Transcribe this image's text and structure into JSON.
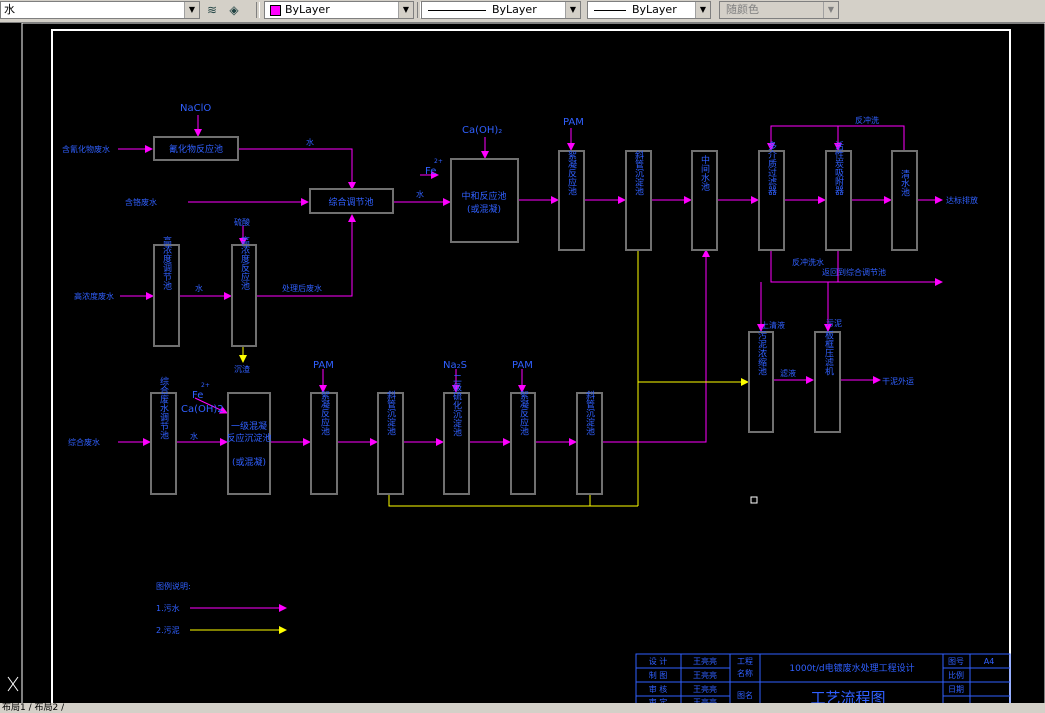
{
  "toolbar": {
    "layer_name": "水",
    "color_value": "ByLayer",
    "linetype_value": "ByLayer",
    "lineweight_value": "ByLayer",
    "plotstyle_value": "随颜色",
    "colors": {
      "swatch": "#ff00ff"
    }
  },
  "drawing": {
    "inputs": {
      "cyanide": "含氰化物废水",
      "chromium": "含铬废水",
      "heavy_metal": "高浓度废水",
      "mixed": "综合废水"
    },
    "reagents": {
      "naclo": "NaClO",
      "caoh2": "Ca(OH)₂",
      "pam1": "PAM",
      "fe": "Fe",
      "fe2": "2+",
      "fe_caoh": "Ca(OH)2",
      "pam2": "PAM",
      "na2s": "Na₂S",
      "pam3": "PAM",
      "acid": "硫酸"
    },
    "units": {
      "cn_oxid": "氰化物反应池",
      "mixing": "综合调节池",
      "neutral": "中和反应池",
      "neutral_sub": "(或混凝)",
      "coag1": "絮凝反应池",
      "sed1": "斜管沉淀池",
      "mid": "中间水池",
      "filter": "多介质过滤器",
      "carbon": "活性炭吸附器",
      "clear": "清水池",
      "heavy_reg": "高浓度调节池",
      "heavy_react": "高浓度反应池",
      "mixed_reg": "综合废水调节池",
      "stage1": "一级混凝",
      "stage1b": "反应沉淀池",
      "stage1c": "(或混凝)",
      "coag2": "絮凝反应池",
      "sed2": "斜管沉淀池",
      "stage2": "二级硫化沉淀池",
      "coag3": "絮凝反应池",
      "sed3": "斜管沉淀池",
      "thick": "污泥浓缩池",
      "press": "板框压滤机"
    },
    "labels": {
      "water_a": "水",
      "water_b": "水",
      "water_c": "水",
      "water_d": "水",
      "treated": "处理后废水",
      "backwash_top": "反冲洗",
      "backwash": "反冲洗水",
      "return_note": "返回到综合调节池",
      "supernatant": "上清液",
      "filtrate": "滤液",
      "sludge_up": "污泥",
      "cake": "干泥外运",
      "reuse": "达标排放",
      "sediment": "沉渣",
      "sludge_mid": "污泥"
    },
    "legend": {
      "title": "图例说明:",
      "item1": "1.污水",
      "item2": "2.污泥"
    },
    "title_block": {
      "r1c1": "设 计",
      "r1c2": "王亮亮",
      "r1c3": "工程",
      "r1c3b": "名称",
      "project": "1000t/d电镀废水处理工程设计",
      "r2c1": "制 图",
      "r2c2": "王亮亮",
      "r3c1": "审 核",
      "r3c2": "王亮亮",
      "r4c1": "审 定",
      "r4c2": "王亮亮",
      "r3c3": "图名",
      "drawing_title": "工艺流程图",
      "k1": "图号",
      "v1": "A4",
      "k2": "比例",
      "k3": "日期"
    }
  },
  "status": {
    "tabs": "布局1 / 布局2 /"
  }
}
